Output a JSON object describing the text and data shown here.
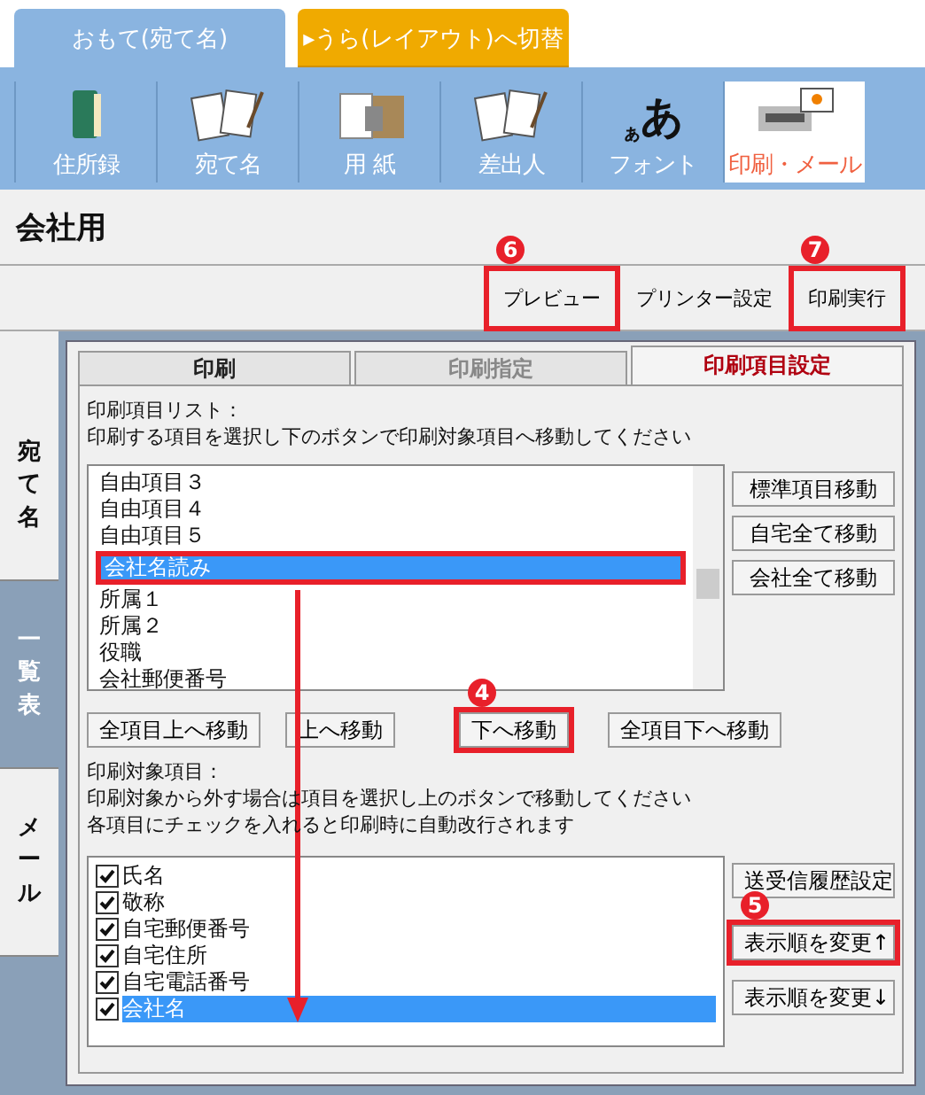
{
  "top_tabs": [
    {
      "label": "おもて(宛て名)",
      "kind": "front",
      "selected": true
    },
    {
      "label": "▸うら(レイアウト)へ切替",
      "kind": "switch",
      "selected": false
    }
  ],
  "toolbar": [
    {
      "label": "住所録",
      "kind": "book",
      "selected": false
    },
    {
      "label": "宛て名",
      "kind": "cards",
      "selected": false
    },
    {
      "label": "用 紙",
      "kind": "paper",
      "selected": false
    },
    {
      "label": "差出人",
      "kind": "cards",
      "selected": false
    },
    {
      "label": "フォント",
      "kind": "font",
      "glyphs": [
        "ぁ",
        "あ"
      ],
      "selected": false
    },
    {
      "label": "印刷・メール",
      "kind": "printer",
      "selected": true
    }
  ],
  "title": "会社用",
  "actions": [
    {
      "label": "プレビュー",
      "callout": "6"
    },
    {
      "label": "プリンター設定"
    },
    {
      "label": "印刷実行",
      "callout": "7"
    }
  ],
  "side_tabs": [
    {
      "label": "宛て名",
      "selected": false
    },
    {
      "label": "一覧表",
      "selected": true
    },
    {
      "label": "メール",
      "selected": false
    }
  ],
  "panel_tabs": [
    {
      "label": "印刷",
      "selected": false,
      "disabled": false
    },
    {
      "label": "印刷指定",
      "selected": false,
      "disabled": true
    },
    {
      "label": "印刷項目設定",
      "selected": true,
      "disabled": false
    }
  ],
  "item_list": {
    "heading": "印刷項目リスト：",
    "hint": "印刷する項目を選択し下のボタンで印刷対象項目へ移動してください",
    "items": [
      {
        "label": "自由項目３",
        "selected": false
      },
      {
        "label": "自由項目４",
        "selected": false
      },
      {
        "label": "自由項目５",
        "selected": false
      },
      {
        "label": "会社名読み",
        "selected": true,
        "highlighted": true
      },
      {
        "label": "所属１",
        "selected": false
      },
      {
        "label": "所属２",
        "selected": false
      },
      {
        "label": "役職",
        "selected": false
      },
      {
        "label": "会社郵便番号",
        "selected": false
      }
    ],
    "side_buttons": [
      {
        "label": "標準項目移動"
      },
      {
        "label": "自宅全て移動"
      },
      {
        "label": "会社全て移動"
      }
    ]
  },
  "move_buttons": [
    {
      "label": "全項目上へ移動"
    },
    {
      "label": "上へ移動"
    },
    {
      "label": "下へ移動",
      "callout": "4"
    },
    {
      "label": "全項目下へ移動"
    }
  ],
  "target_list": {
    "heading": "印刷対象項目：",
    "hints": [
      "印刷対象から外す場合は項目を選択し上のボタンで移動してください",
      "各項目にチェックを入れると印刷時に自動改行されます"
    ],
    "items": [
      {
        "label": "氏名",
        "checked": true,
        "selected": false
      },
      {
        "label": "敬称",
        "checked": true,
        "selected": false
      },
      {
        "label": "自宅郵便番号",
        "checked": true,
        "selected": false
      },
      {
        "label": "自宅住所",
        "checked": true,
        "selected": false
      },
      {
        "label": "自宅電話番号",
        "checked": true,
        "selected": false
      },
      {
        "label": "会社名",
        "checked": true,
        "selected": true
      }
    ],
    "side_buttons": [
      {
        "label": "送受信履歴設定"
      },
      {
        "label": "表示順を変更↑",
        "callout": "5"
      },
      {
        "label": "表示順を変更↓"
      }
    ]
  }
}
